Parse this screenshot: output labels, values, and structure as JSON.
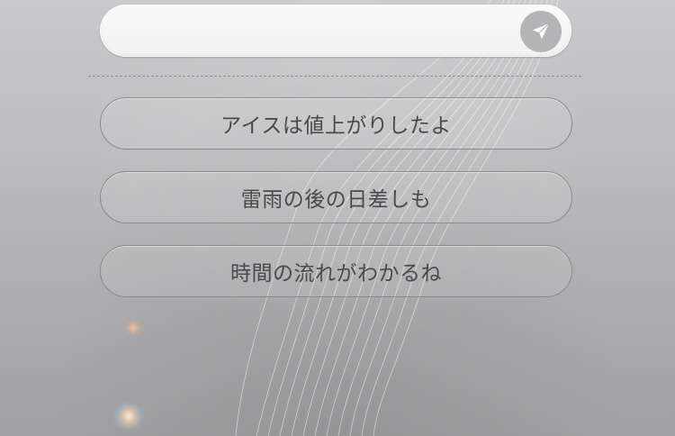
{
  "composer": {
    "input_value": "",
    "send_icon": "paper-plane-icon"
  },
  "options": [
    {
      "label": "アイスは値上がりしたよ"
    },
    {
      "label": "雷雨の後の日差しも"
    },
    {
      "label": "時間の流れがわかるね"
    }
  ],
  "colors": {
    "background_top": "#c9c9cb",
    "background_bottom": "#a1a1a3",
    "input_fill": "#f4f4f6",
    "send_button_fill": "#b4b4b6",
    "option_border": "#8a8a8c",
    "option_text": "#4a4a4c"
  }
}
